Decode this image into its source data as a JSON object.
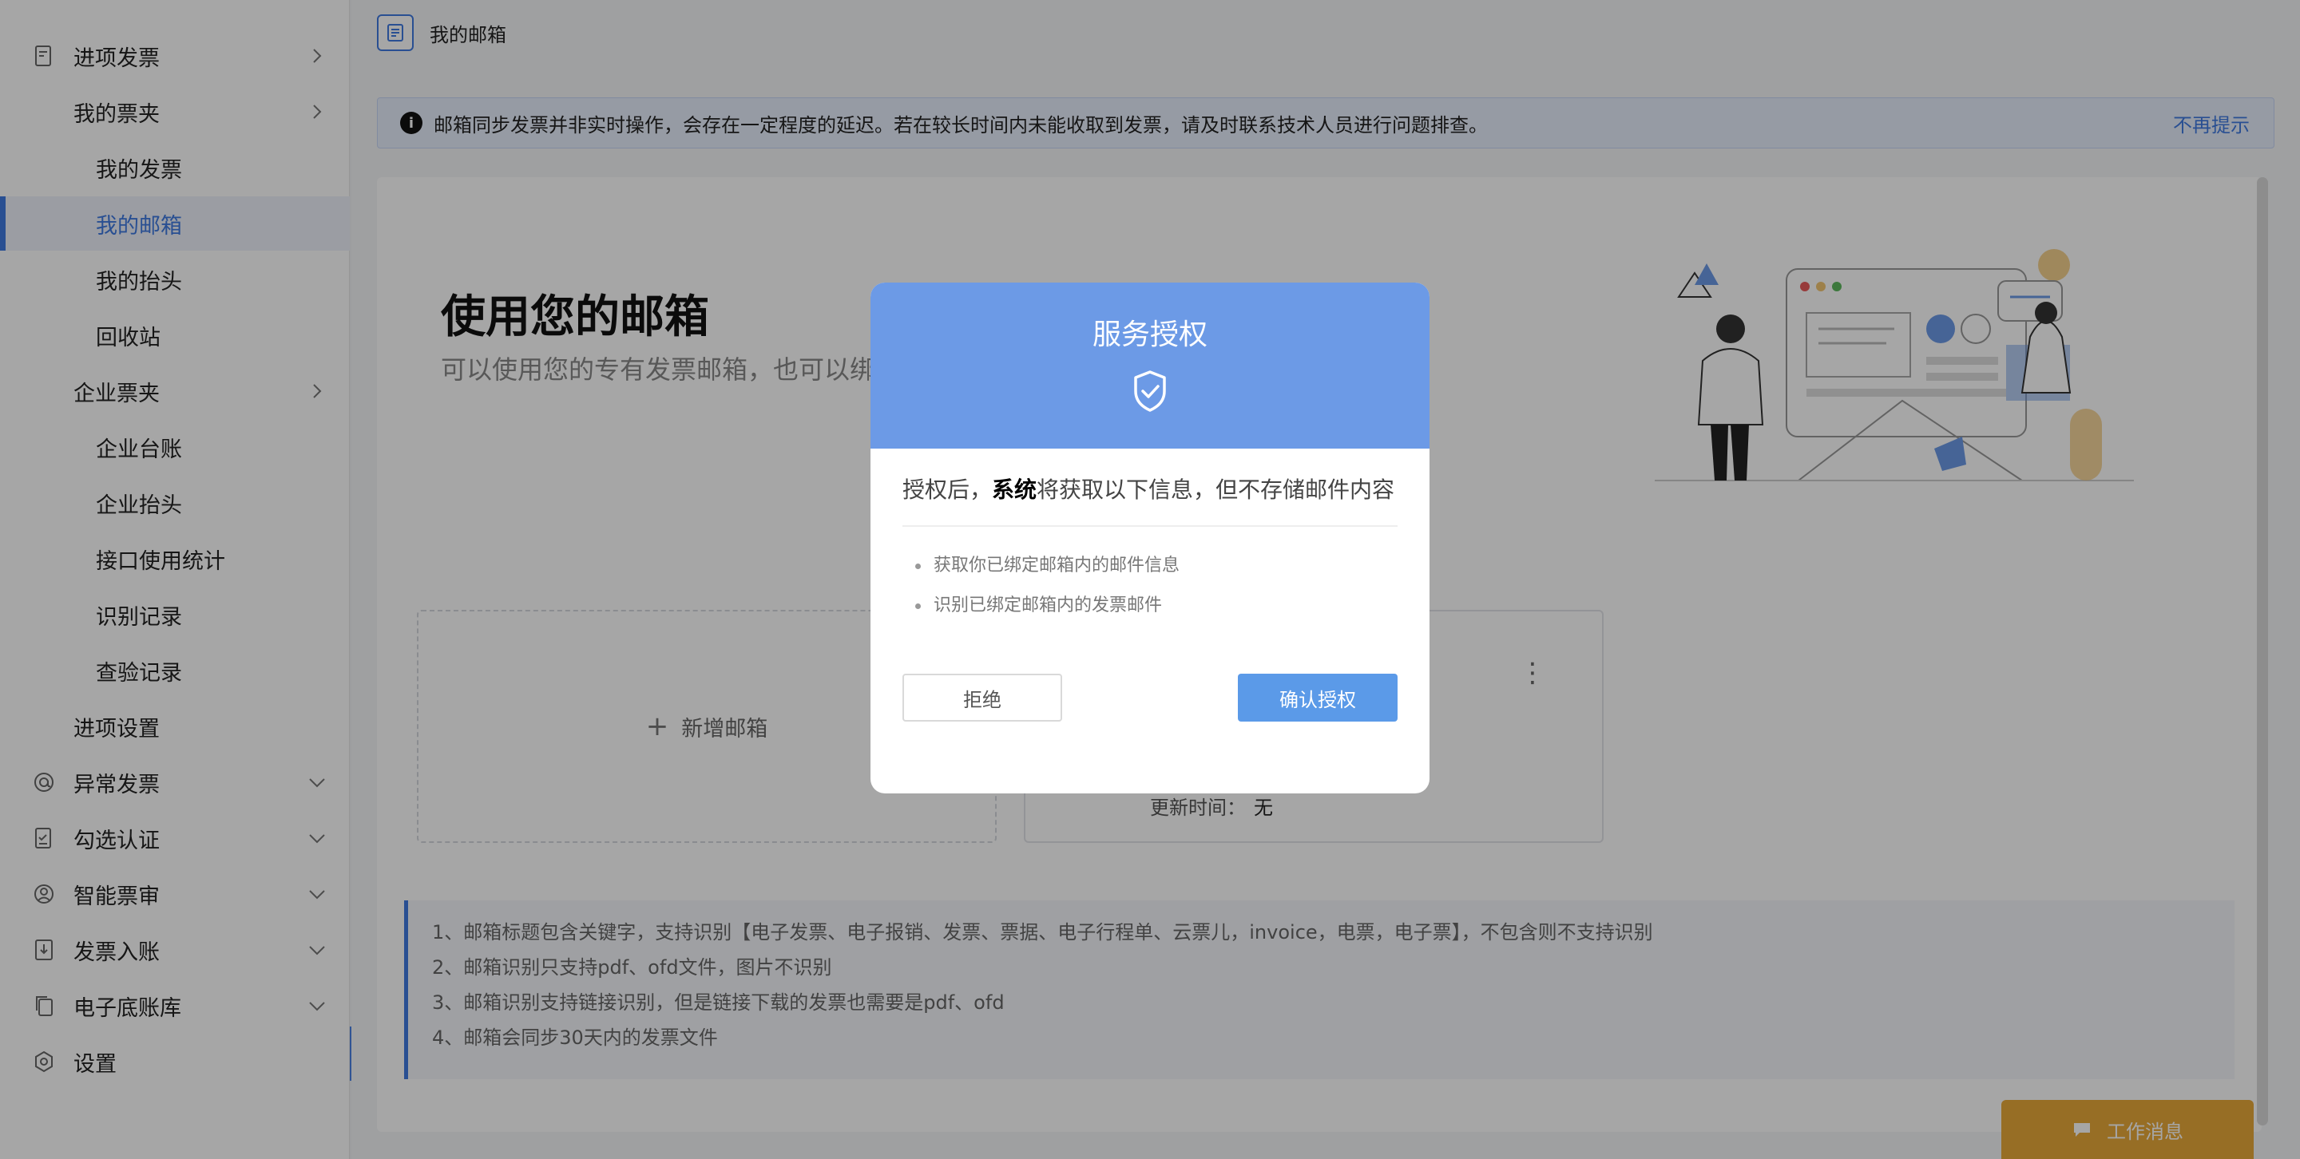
{
  "sidebar": {
    "items": [
      {
        "label": "进项发票",
        "icon": "invoice-icon",
        "chevron": "right"
      },
      {
        "label": "我的票夹",
        "chevron": "right"
      },
      {
        "label": "我的发票"
      },
      {
        "label": "我的邮箱",
        "active": true
      },
      {
        "label": "我的抬头"
      },
      {
        "label": "回收站"
      },
      {
        "label": "企业票夹",
        "chevron": "right"
      },
      {
        "label": "企业台账"
      },
      {
        "label": "企业抬头"
      },
      {
        "label": "接口使用统计"
      },
      {
        "label": "识别记录"
      },
      {
        "label": "查验记录"
      },
      {
        "label": "进项设置"
      },
      {
        "label": "异常发票",
        "icon": "at-icon",
        "chevron": "down"
      },
      {
        "label": "勾选认证",
        "icon": "checklist-icon",
        "chevron": "down"
      },
      {
        "label": "智能票审",
        "icon": "user-circle-icon",
        "chevron": "down"
      },
      {
        "label": "发票入账",
        "icon": "download-box-icon",
        "chevron": "down"
      },
      {
        "label": "电子底账库",
        "icon": "copy-icon",
        "chevron": "down"
      },
      {
        "label": "设置",
        "icon": "settings-icon"
      }
    ],
    "collapse_icon": "chevron-left-icon"
  },
  "header": {
    "title": "我的邮箱"
  },
  "notice": {
    "text": "邮箱同步发票并非实时操作，会存在一定程度的延迟。若在较长时间内未能收取到发票，请及时联系技术人员进行问题排查。",
    "dismiss": "不再提示"
  },
  "main": {
    "heading": "使用您的邮箱",
    "subheading": "可以使用您的专有发票邮箱，也可以绑",
    "add_mailbox": "新增邮箱",
    "update_label": "更新时间：",
    "update_value": "无",
    "tips": [
      "1、邮箱标题包含关键字，支持识别【电子发票、电子报销、发票、票据、电子行程单、云票儿，invoice，电票，电子票】，不包含则不支持识别",
      "2、邮箱识别只支持pdf、ofd文件，图片不识别",
      "3、邮箱识别支持链接识别，但是链接下载的发票也需要是pdf、ofd",
      "4、邮箱会同步30天内的发票文件"
    ]
  },
  "chat": {
    "label": "工作消息"
  },
  "modal": {
    "title": "服务授权",
    "lead_prefix": "授权后，",
    "lead_bold": "系统",
    "lead_suffix": "将获取以下信息，但不存储邮件内容",
    "permissions": [
      "获取你已绑定邮箱内的邮件信息",
      "识别已绑定邮箱内的发票邮件"
    ],
    "reject": "拒绝",
    "confirm": "确认授权"
  },
  "colors": {
    "accent": "#3f7ae0",
    "modal_header": "#6c9ae6",
    "confirm": "#5b9ae8",
    "chat": "#e8a93a"
  }
}
